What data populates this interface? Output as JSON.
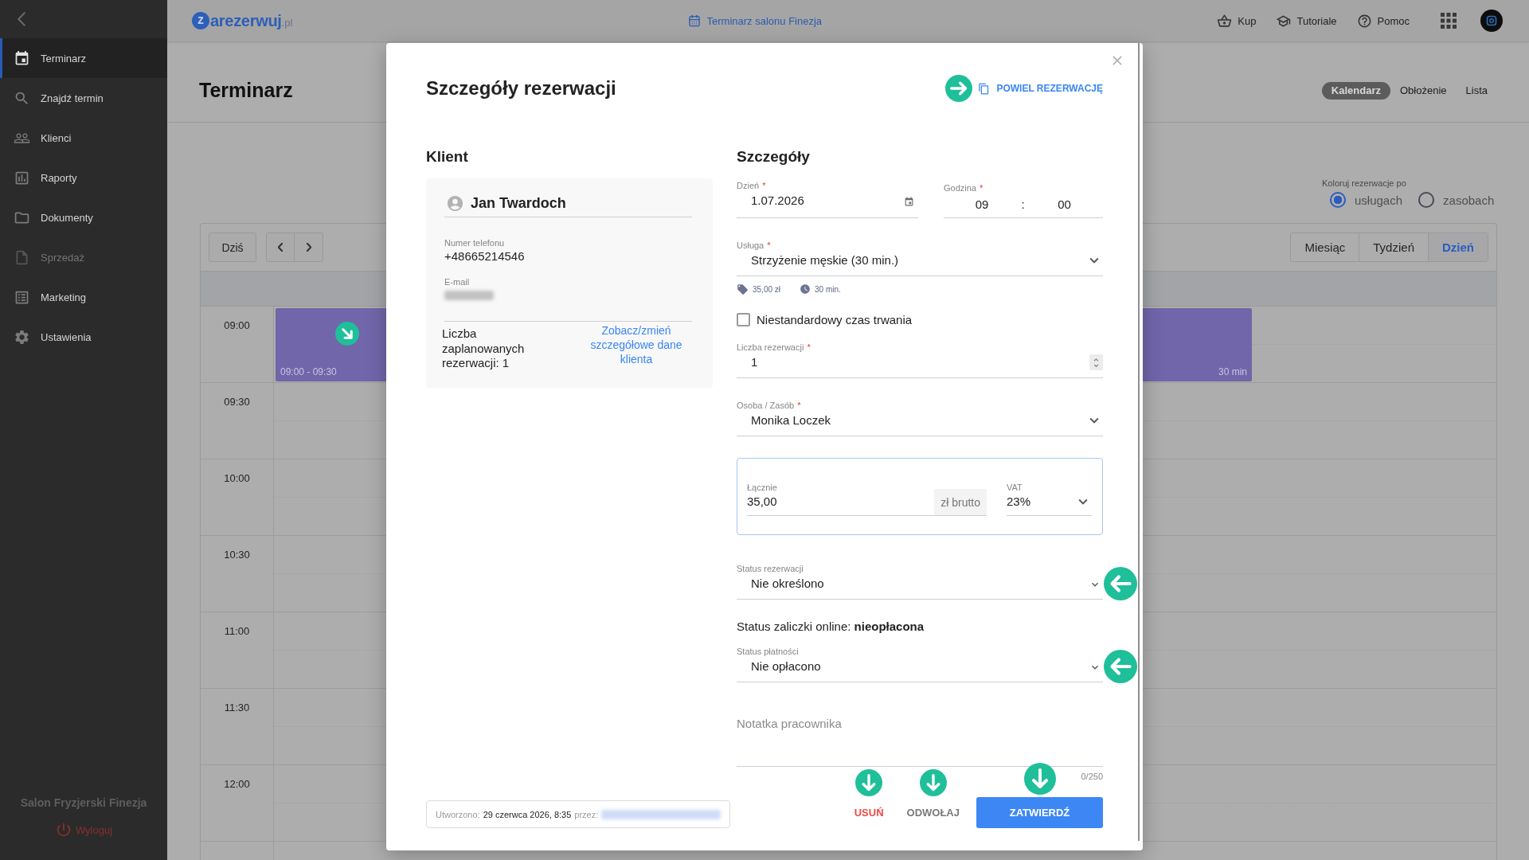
{
  "sidebar": {
    "items": [
      {
        "label": "Terminarz",
        "selected": true,
        "disabled": false
      },
      {
        "label": "Znajdź termin",
        "selected": false,
        "disabled": false
      },
      {
        "label": "Klienci",
        "selected": false,
        "disabled": false
      },
      {
        "label": "Raporty",
        "selected": false,
        "disabled": false
      },
      {
        "label": "Dokumenty",
        "selected": false,
        "disabled": false
      },
      {
        "label": "Sprzedaż",
        "selected": false,
        "disabled": true
      },
      {
        "label": "Marketing",
        "selected": false,
        "disabled": false
      },
      {
        "label": "Ustawienia",
        "selected": false,
        "disabled": false
      }
    ],
    "salon_name": "Salon Fryzjerski Finezja",
    "logout": "Wyloguj"
  },
  "topbar": {
    "logo": {
      "mark": "z",
      "name": "arezerwuj",
      "domain": ".pl"
    },
    "calendar_link": "Terminarz salonu Finezja",
    "links": [
      "Kup",
      "Tutoriale",
      "Pomoc"
    ]
  },
  "page": {
    "title": "Terminarz",
    "view_tabs": [
      {
        "label": "Kalendarz",
        "selected": true
      },
      {
        "label": "Obłożenie",
        "selected": false
      },
      {
        "label": "Lista",
        "selected": false
      }
    ],
    "color_by": {
      "label": "Koloruj rezerwacje po",
      "options": [
        {
          "label": "usługach",
          "selected": true
        },
        {
          "label": "zasobach",
          "selected": false
        }
      ]
    }
  },
  "calendar": {
    "today": "Dziś",
    "range_tabs": [
      {
        "label": "Miesiąc",
        "selected": false
      },
      {
        "label": "Tydzień",
        "selected": false
      },
      {
        "label": "Dzień",
        "selected": true
      }
    ],
    "times": [
      "09:00",
      "09:30",
      "10:00",
      "10:30",
      "11:00",
      "11:30",
      "12:00"
    ],
    "events": [
      {
        "time": "09:00 - 09:30",
        "duration": "30 min",
        "arrow": true
      }
    ]
  },
  "modal": {
    "title": "Szczegóły rezerwacji",
    "duplicate": {
      "label": "POWIEL REZERWACJĘ",
      "arrow": true
    },
    "client": {
      "heading": "Klient",
      "name": "Jan Twardoch",
      "phone_label": "Numer telefonu",
      "phone": "+48665214546",
      "email_label": "E-mail",
      "planned": "Liczba zaplanowanych rezerwacji: 1",
      "details_link": "Zobacz/zmień szczegółowe dane klienta"
    },
    "details": {
      "heading": "Szczegóły",
      "date": {
        "label": "Dzień",
        "required_mark": "*",
        "value": "1.07.2026"
      },
      "time": {
        "label": "Godzina",
        "required_mark": "*",
        "hour": "09",
        "separator": ":",
        "minute": "00"
      },
      "service": {
        "label": "Usługa",
        "required_mark": "*",
        "value": "Strzyżenie męskie (30 min.)",
        "price": "35,00 zł",
        "duration": "30 min."
      },
      "custom_duration": {
        "label": "Niestandardowy czas trwania",
        "checked": false
      },
      "count": {
        "label": "Liczba rezerwacji",
        "required_mark": "*",
        "value": "1"
      },
      "resource": {
        "label": "Osoba / Zasób",
        "required_mark": "*",
        "value": "Monika Loczek"
      },
      "total": {
        "label": "Łącznie",
        "value": "35,00",
        "unit": "zł brutto",
        "vat_label": "VAT",
        "vat": "23%"
      },
      "status": {
        "label": "Status rezerwacji",
        "value": "Nie określono",
        "arrow": true
      },
      "deposit": "Status zaliczki online: **nieopłacona**",
      "payment": {
        "label": "Status płatności",
        "value": "Nie opłacono",
        "arrow": true
      },
      "note": {
        "placeholder": "Notatka pracownika",
        "counter": "0/250"
      }
    },
    "created": {
      "label": "Utworzono:",
      "date": "29 czerwca 2026, 8:35",
      "by_label": "przez:"
    },
    "buttons": [
      {
        "label": "USUŃ",
        "kind": "danger",
        "arrow": true
      },
      {
        "label": "ODWOŁAJ",
        "kind": "secondary",
        "arrow": true
      },
      {
        "label": "ZATWIERDŹ",
        "kind": "primary",
        "arrow": true
      }
    ]
  }
}
